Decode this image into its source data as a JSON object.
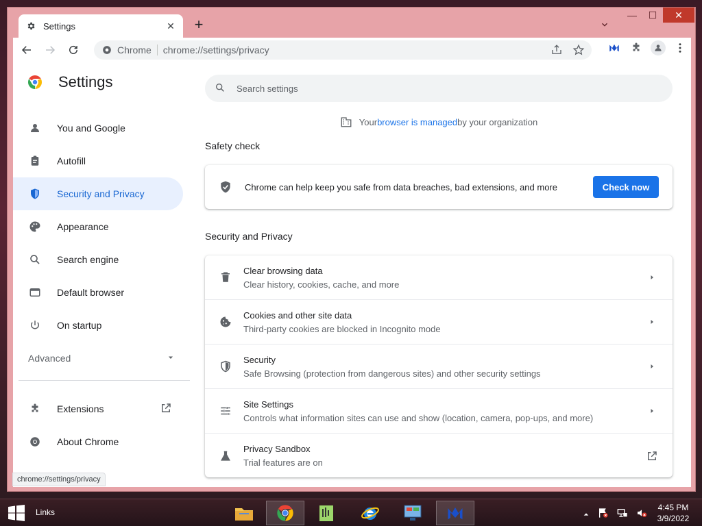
{
  "tab": {
    "title": "Settings",
    "close_glyph": "✕"
  },
  "newtab_glyph": "+",
  "window_controls": {
    "minimize": "—",
    "maximize": "☐",
    "close": "✕"
  },
  "omnibox": {
    "chip": "Chrome",
    "url": "chrome://settings/privacy"
  },
  "brand": {
    "title": "Settings"
  },
  "sidebar": {
    "items": [
      {
        "label": "You and Google",
        "icon": "person-icon"
      },
      {
        "label": "Autofill",
        "icon": "clipboard-icon"
      },
      {
        "label": "Security and Privacy",
        "icon": "shield-icon",
        "active": true
      },
      {
        "label": "Appearance",
        "icon": "palette-icon"
      },
      {
        "label": "Search engine",
        "icon": "search-icon"
      },
      {
        "label": "Default browser",
        "icon": "browser-icon"
      },
      {
        "label": "On startup",
        "icon": "power-icon"
      }
    ],
    "advanced": "Advanced",
    "extensions": "Extensions",
    "about": "About Chrome"
  },
  "search": {
    "placeholder": "Search settings"
  },
  "managed": {
    "prefix": "Your ",
    "link": "browser is managed",
    "suffix": " by your organization"
  },
  "safety": {
    "title": "Safety check",
    "text": "Chrome can help keep you safe from data breaches, bad extensions, and more",
    "button": "Check now"
  },
  "privacy": {
    "title": "Security and Privacy",
    "rows": [
      {
        "title": "Clear browsing data",
        "subtitle": "Clear history, cookies, cache, and more",
        "icon": "trash-icon"
      },
      {
        "title": "Cookies and other site data",
        "subtitle": "Third-party cookies are blocked in Incognito mode",
        "icon": "cookie-icon"
      },
      {
        "title": "Security",
        "subtitle": "Safe Browsing (protection from dangerous sites) and other security settings",
        "icon": "shield-icon"
      },
      {
        "title": "Site Settings",
        "subtitle": "Controls what information sites can use and show (location, camera, pop-ups, and more)",
        "icon": "tune-icon"
      },
      {
        "title": "Privacy Sandbox",
        "subtitle": "Trial features are on",
        "icon": "flask-icon"
      }
    ]
  },
  "statusbar": "chrome://settings/privacy",
  "taskbar": {
    "links": "Links",
    "time": "4:45 PM",
    "date": "3/9/2022"
  },
  "colors": {
    "accent": "#1a73e8",
    "active_bg": "#e8f0fe",
    "frame": "#e7a3a8"
  }
}
